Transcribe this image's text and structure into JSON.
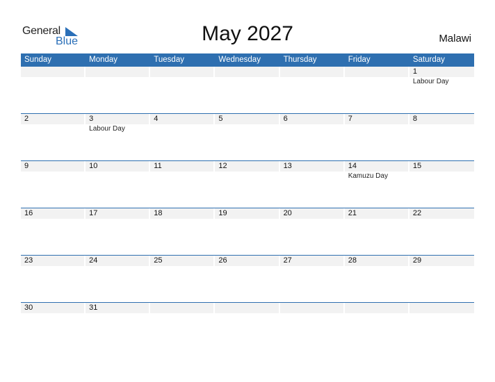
{
  "logo": {
    "general": "General",
    "blue": "Blue",
    "brand_color": "#2a6fb8"
  },
  "title": "May 2027",
  "country": "Malawi",
  "header_color": "#2e6fb0",
  "weekdays": [
    "Sunday",
    "Monday",
    "Tuesday",
    "Wednesday",
    "Thursday",
    "Friday",
    "Saturday"
  ],
  "weeks": [
    [
      {
        "d": ""
      },
      {
        "d": ""
      },
      {
        "d": ""
      },
      {
        "d": ""
      },
      {
        "d": ""
      },
      {
        "d": ""
      },
      {
        "d": "1",
        "h": "Labour Day"
      }
    ],
    [
      {
        "d": "2"
      },
      {
        "d": "3",
        "h": "Labour Day"
      },
      {
        "d": "4"
      },
      {
        "d": "5"
      },
      {
        "d": "6"
      },
      {
        "d": "7"
      },
      {
        "d": "8"
      }
    ],
    [
      {
        "d": "9"
      },
      {
        "d": "10"
      },
      {
        "d": "11"
      },
      {
        "d": "12"
      },
      {
        "d": "13"
      },
      {
        "d": "14",
        "h": "Kamuzu Day"
      },
      {
        "d": "15"
      }
    ],
    [
      {
        "d": "16"
      },
      {
        "d": "17"
      },
      {
        "d": "18"
      },
      {
        "d": "19"
      },
      {
        "d": "20"
      },
      {
        "d": "21"
      },
      {
        "d": "22"
      }
    ],
    [
      {
        "d": "23"
      },
      {
        "d": "24"
      },
      {
        "d": "25"
      },
      {
        "d": "26"
      },
      {
        "d": "27"
      },
      {
        "d": "28"
      },
      {
        "d": "29"
      }
    ],
    [
      {
        "d": "30"
      },
      {
        "d": "31"
      },
      {
        "d": ""
      },
      {
        "d": ""
      },
      {
        "d": ""
      },
      {
        "d": ""
      },
      {
        "d": ""
      }
    ]
  ]
}
